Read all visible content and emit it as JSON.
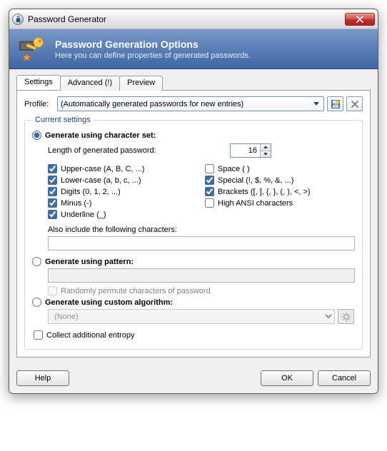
{
  "window": {
    "title": "Password Generator"
  },
  "banner": {
    "title": "Password Generation Options",
    "subtitle": "Here you can define properties of generated passwords."
  },
  "tabs": {
    "settings": "Settings",
    "advanced": "Advanced (!)",
    "preview": "Preview"
  },
  "profile": {
    "label": "Profile:",
    "selected": "(Automatically generated passwords for new entries)"
  },
  "group": {
    "legend": "Current settings",
    "mode_charset": "Generate using character set:",
    "length_label": "Length of generated password:",
    "length_value": "16",
    "opts": {
      "upper": "Upper-case (A, B, C, ...)",
      "lower": "Lower-case (a, b, c, ...)",
      "digits": "Digits (0, 1, 2, ...)",
      "minus": "Minus (-)",
      "under": "Underline (_)",
      "space": "Space ( )",
      "special": "Special (!, $, %, &, ...)",
      "brackets": "Brackets ([, ], {, }, (, ), <, >)",
      "ansi": "High ANSI characters"
    },
    "also_label": "Also include the following characters:",
    "mode_pattern": "Generate using pattern:",
    "permute_label": "Randomly permute characters of password",
    "mode_algo": "Generate using custom algorithm:",
    "algo_selected": "(None)",
    "collect_entropy": "Collect additional entropy"
  },
  "buttons": {
    "help": "Help",
    "ok": "OK",
    "cancel": "Cancel"
  }
}
